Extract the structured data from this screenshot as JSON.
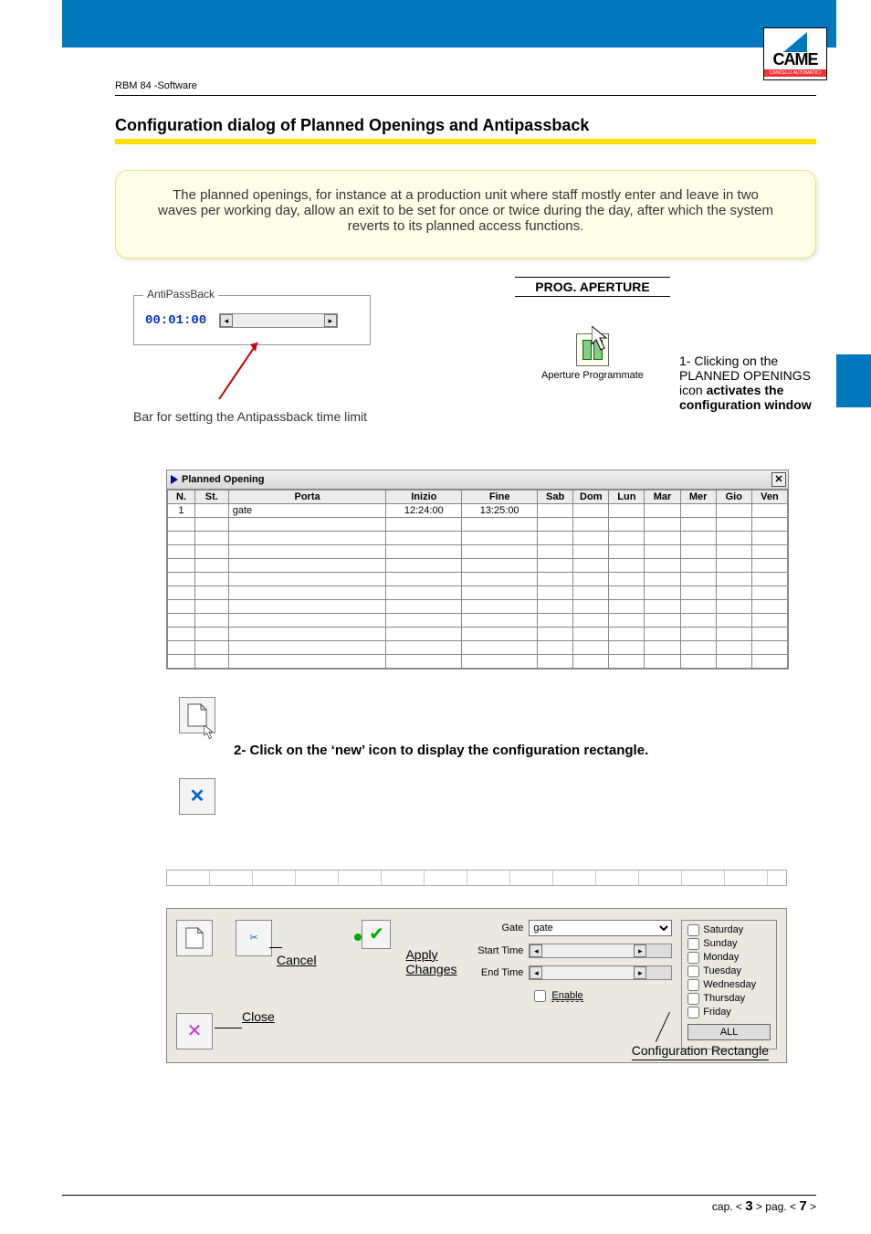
{
  "header": {
    "doc_id": "RBM 84 -Software",
    "title": "Configuration dialog of Planned Openings and Antipassback",
    "logo_text": "CAME",
    "logo_sub": "CANCELLI AUTOMATICI"
  },
  "intro": "The planned openings, for instance at a production unit where staff mostly enter and leave in two waves per working day, allow an exit to be set for once or twice during the day, after which the system reverts to its planned access functions.",
  "antipassback": {
    "legend": "AntiPassBack",
    "time": "00:01:00",
    "caption": "Bar for setting the Antipassback time limit"
  },
  "prog_aperture": {
    "title": "PROG. APERTURE",
    "icon_label": "Aperture Programmate"
  },
  "note1": {
    "line1": "1- Clicking on the PLANNED OPENINGS icon",
    "line2": "activates the configuration window"
  },
  "po_window": {
    "title": "Planned Opening",
    "columns": {
      "n": "N.",
      "st": "St.",
      "porta": "Porta",
      "inizio": "Inizio",
      "fine": "Fine",
      "sab": "Sab",
      "dom": "Dom",
      "lun": "Lun",
      "mar": "Mar",
      "mer": "Mer",
      "gio": "Gio",
      "ven": "Ven"
    },
    "rows": [
      {
        "n": "1",
        "st": "",
        "porta": "gate",
        "inizio": "12:24:00",
        "fine": "13:25:00",
        "sab": "",
        "dom": "",
        "lun": "",
        "mar": "",
        "mer": "",
        "gio": "",
        "ven": ""
      }
    ]
  },
  "step2": "2- Click on the ‘new’ icon to display the configuration rectangle.",
  "cfg": {
    "cancel": "Cancel",
    "close": "Close",
    "apply": "Apply Changes",
    "gate_label": "Gate",
    "gate_value": "gate",
    "start_label": "Start Time",
    "end_label": "End Time",
    "enable_label": "Enable",
    "days": [
      "Saturday",
      "Sunday",
      "Monday",
      "Tuesday",
      "Wednesday",
      "Thursday",
      "Friday"
    ],
    "all": "ALL",
    "caption": "Configuration Rectangle"
  },
  "pager": {
    "cap": "3",
    "pag": "7",
    "prefix_cap": "cap. < ",
    "mid": " > pag. < ",
    "suffix": " >"
  }
}
